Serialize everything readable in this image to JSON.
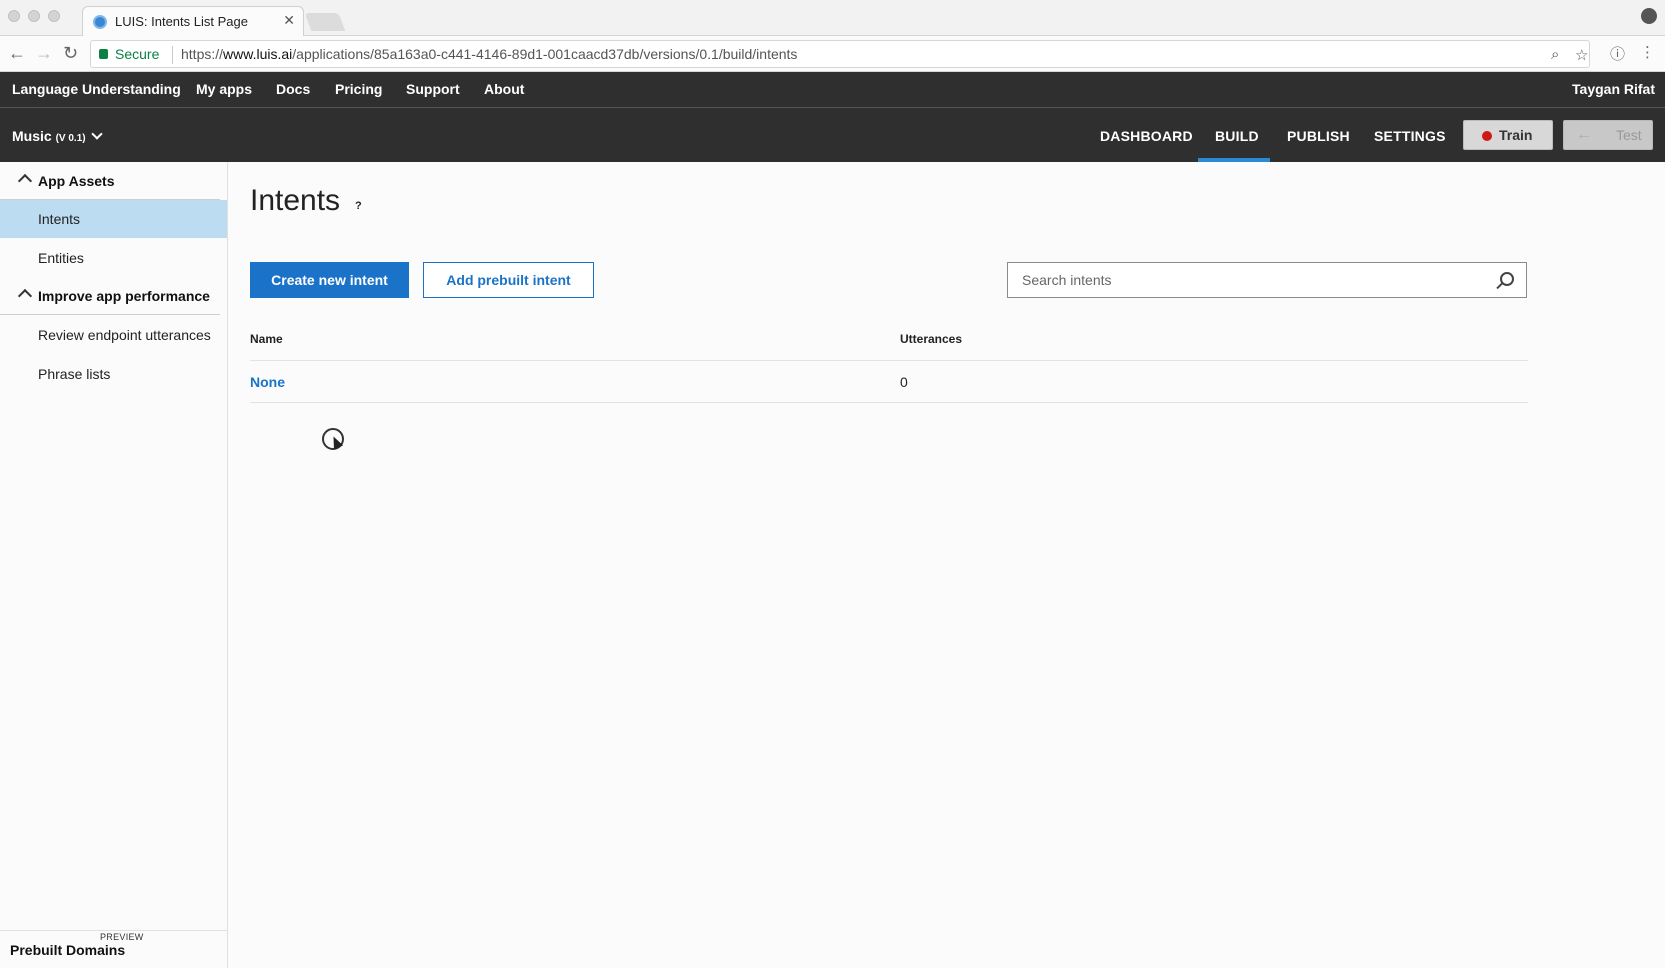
{
  "browser": {
    "tab_title": "LUIS: Intents List Page",
    "secure_label": "Secure",
    "url_scheme": "https://",
    "url_host": "www.luis.ai",
    "url_path": "/applications/85a163a0-c441-4146-89d1-001caacd37db/versions/0.1/build/intents"
  },
  "topnav": {
    "brand": "Language Understanding",
    "links": [
      "My apps",
      "Docs",
      "Pricing",
      "Support",
      "About"
    ],
    "user": "Taygan Rifat"
  },
  "subnav": {
    "app_name": "Music",
    "app_version": "(V 0.1)",
    "tabs": [
      "DASHBOARD",
      "BUILD",
      "PUBLISH",
      "SETTINGS"
    ],
    "active_tab": "BUILD",
    "train_label": "Train",
    "test_label": "Test"
  },
  "sidebar": {
    "groups": [
      {
        "label": "App Assets",
        "items": [
          "Intents",
          "Entities"
        ]
      },
      {
        "label": "Improve app performance",
        "items": [
          "Review endpoint utterances",
          "Phrase lists"
        ]
      }
    ],
    "active_item": "Intents",
    "preview_badge": "PREVIEW",
    "prebuilt_domains": "Prebuilt Domains"
  },
  "main": {
    "title": "Intents",
    "help": "?",
    "create_button": "Create new intent",
    "add_prebuilt_button": "Add prebuilt intent",
    "search_placeholder": "Search intents",
    "table": {
      "columns": [
        "Name",
        "Utterances"
      ],
      "rows": [
        {
          "name": "None",
          "utterances": "0"
        }
      ]
    }
  },
  "colors": {
    "header_bg": "#2f2f2f",
    "accent_blue": "#1a73c8",
    "active_sidebar": "#bcdcf2",
    "train_dot": "#d01717",
    "secure_green": "#0b8043"
  }
}
